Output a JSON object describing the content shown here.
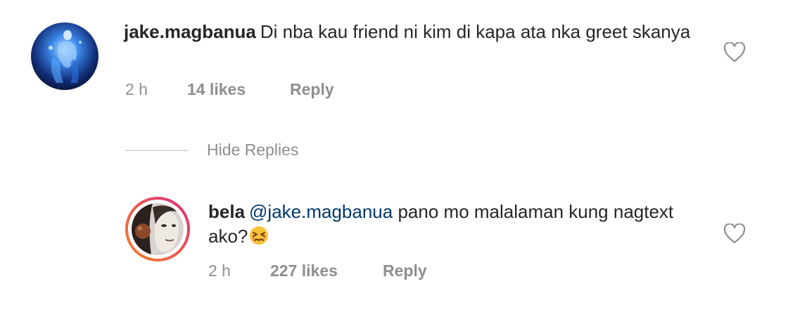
{
  "comments": [
    {
      "username": "jake.magbanua",
      "text": "Di nba kau friend ni kim di kapa ata nka greet skanya",
      "time": "2 h",
      "likes": "14 likes",
      "reply_label": "Reply",
      "liked": false
    }
  ],
  "hide_replies_label": "Hide Replies",
  "replies": [
    {
      "username": "bela",
      "mention": "@jake.magbanua",
      "text": "pano mo malalaman kung nagtext ako?",
      "emoji": "😣",
      "time": "2 h",
      "likes": "227 likes",
      "reply_label": "Reply",
      "liked": false
    }
  ],
  "colors": {
    "text": "#262626",
    "secondary": "#8e8e8e",
    "mention": "#00376b",
    "divider": "#dbdbdb",
    "story_ring_start": "#f58529",
    "story_ring_end": "#dd2a7b"
  },
  "icons": {
    "like": "heart-outline-icon"
  }
}
